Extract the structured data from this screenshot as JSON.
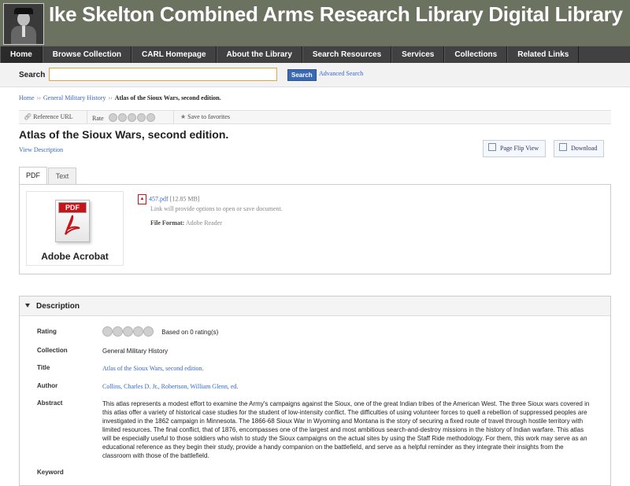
{
  "site": {
    "title": "Ike Skelton Combined Arms Research Library Digital Library"
  },
  "nav": {
    "items": [
      "Home",
      "Browse Collection",
      "CARL Homepage",
      "About the Library",
      "Search Resources",
      "Services",
      "Collections",
      "Related Links"
    ]
  },
  "search": {
    "label": "Search",
    "value": "",
    "placeholder": "",
    "button": "Search",
    "advanced": "Advanced Search"
  },
  "breadcrumb": {
    "home": "Home",
    "collection": "General Military History",
    "current": "Atlas of the Sioux Wars, second edition."
  },
  "toolbar": {
    "reference_url": "Reference URL",
    "rate": "Rate",
    "save": "Save to favorites"
  },
  "item": {
    "title": "Atlas of the Sioux Wars, second edition.",
    "view_description": "View Description",
    "page_flip": "Page Flip View",
    "download": "Download"
  },
  "tabs": [
    "PDF",
    "Text"
  ],
  "file": {
    "acrobat_label": "Adobe Acrobat",
    "acrobat_badge": "PDF",
    "name": "457.pdf",
    "size": "[12.85 MB]",
    "note": "Link will provide options to open or save document.",
    "format_label": "File Format:",
    "format_value": "Adobe Reader"
  },
  "description": {
    "heading": "Description",
    "rating_label": "Rating",
    "rating_text": "Based on 0 rating(s)",
    "collection_label": "Collection",
    "collection_value": "General Military History",
    "title_label": "Title",
    "title_value": "Atlas of the Sioux Wars, second edition.",
    "author_label": "Author",
    "author_value": "Collins, Charles D. Jr., Robertson, William Glenn, ed.",
    "abstract_label": "Abstract",
    "abstract_value": "This atlas represents a modest effort to examine the Army's campaigns against the Sioux, one of the great Indian tribes of the American West. The three Sioux wars covered in this atlas offer a variety of historical case studies for the student of low-intensity conflict. The difficulties of using volunteer forces to quell a rebellion of suppressed peoples are investigated in the 1862 campaign in Minnesota. The 1866-68 Sioux War in Wyoming and Montana is the story of securing a fixed route of travel through hostile territory with limited resources. The final conflict, that of 1876, encompasses one of the largest and most ambitious search-and-destroy missions in the history of Indian warfare. This atlas will be especially useful to those soldiers who wish to study the Sioux campaigns on the actual sites by using the Staff Ride methodology. For them, this work may serve as an educational reference as they begin their study, provide a handy companion on the battlefield, and serve as a helpful reminder as they integrate their insights from the classroom with those of the battlefield.",
    "keyword_label": "Keyword"
  },
  "colors": {
    "header_bg": "#6b7260",
    "nav_bg": "#414141",
    "link": "#3366cc",
    "pdf_red": "#c5151b"
  }
}
